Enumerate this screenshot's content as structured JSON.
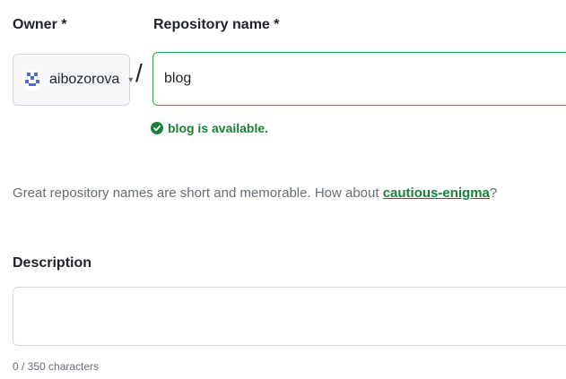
{
  "owner": {
    "label": "Owner *",
    "selected": "aibozorova",
    "caret": "▾",
    "avatar_icon": "identicon-avatar"
  },
  "repo": {
    "label": "Repository name *",
    "separator": "/",
    "value": "blog",
    "availability": "blog is available."
  },
  "hint": {
    "prefix": "Great repository names are short and memorable. How about ",
    "suggestion": "cautious-enigma",
    "suffix": "?"
  },
  "description": {
    "label": "Description",
    "value": "",
    "char_count": "0 / 350 characters"
  },
  "colors": {
    "success": "#1a7f37",
    "border_active": "#2da44e",
    "muted": "#656d76"
  }
}
